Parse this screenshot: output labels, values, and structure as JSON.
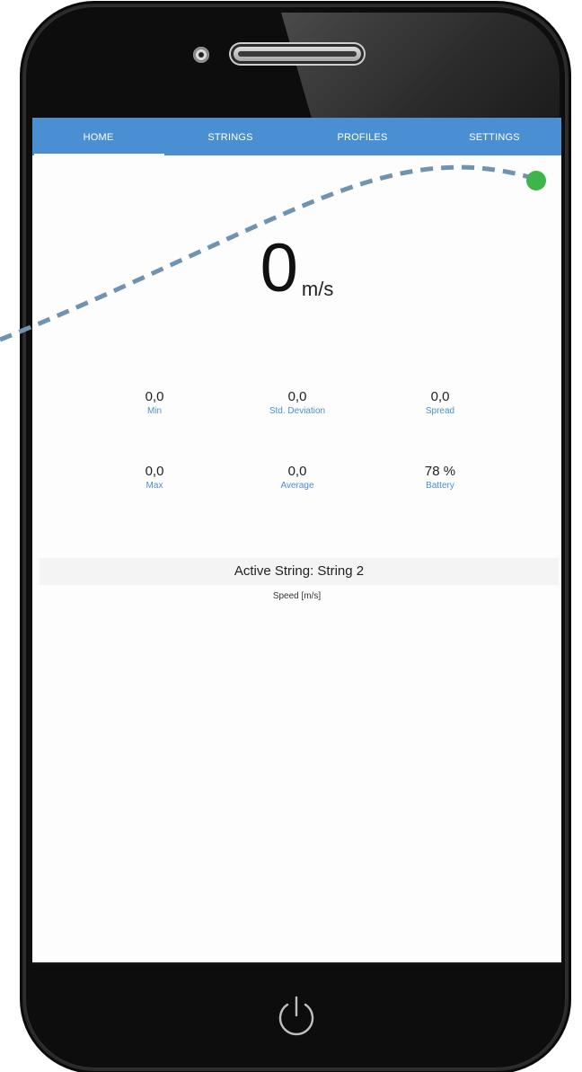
{
  "tabs": [
    {
      "label": "HOME"
    },
    {
      "label": "STRINGS"
    },
    {
      "label": "PROFILES"
    },
    {
      "label": "SETTINGS"
    }
  ],
  "speed": {
    "value": "0",
    "unit": "m/s"
  },
  "stats": {
    "min": {
      "value": "0,0",
      "label": "Min"
    },
    "std_deviation": {
      "value": "0,0",
      "label": "Std. Deviation"
    },
    "spread": {
      "value": "0,0",
      "label": "Spread"
    },
    "max": {
      "value": "0,0",
      "label": "Max"
    },
    "average": {
      "value": "0,0",
      "label": "Average"
    },
    "battery": {
      "value": "78 %",
      "label": "Battery"
    }
  },
  "active_string": "Active String: String 2",
  "chart_axis_label": "Speed [m/s]",
  "colors": {
    "accent": "#4a8fd1",
    "dot": "#3db54a",
    "dash_line": "#6f93b1"
  }
}
